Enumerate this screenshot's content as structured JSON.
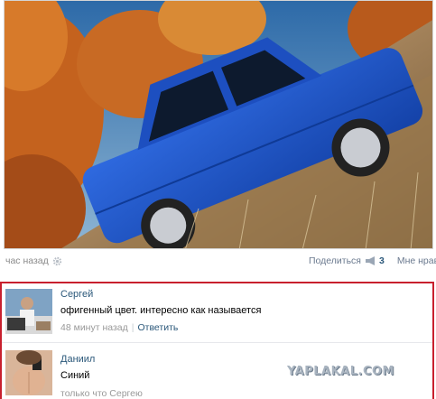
{
  "post": {
    "photo_alt_icon": "car-photo",
    "time": "час назад",
    "share_label": "Поделиться",
    "share_count": "3",
    "like_label": "Мне нрав"
  },
  "comments": [
    {
      "author": "Сергей",
      "text": "офигенный цвет. интересно как называется",
      "time": "48 минут назад",
      "separator": "|",
      "reply_label": "Ответить"
    },
    {
      "author": "Даниил",
      "text": "Синий",
      "time": "только что Сергею"
    }
  ],
  "watermark": "YAPLAKAL.COM",
  "colors": {
    "link": "#2b587a",
    "highlight_border": "#c8202e",
    "car_body": "#1f55c8"
  }
}
